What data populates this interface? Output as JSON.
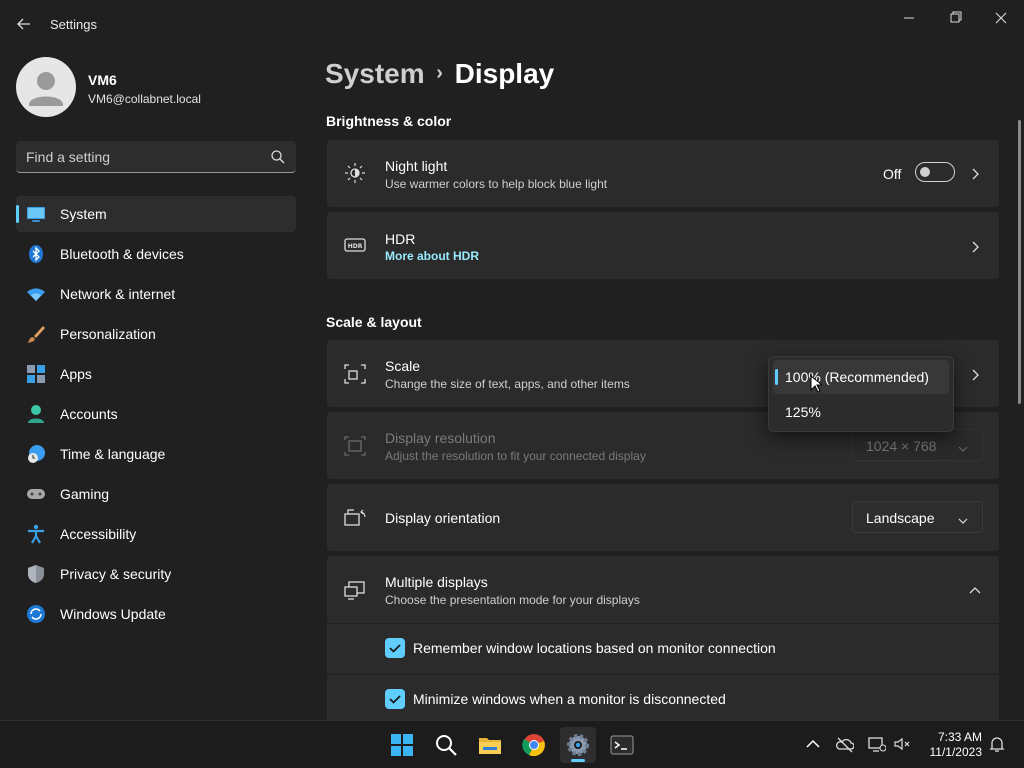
{
  "window": {
    "title": "Settings"
  },
  "user": {
    "name": "VM6",
    "email": "VM6@collabnet.local"
  },
  "search": {
    "placeholder": "Find a setting"
  },
  "nav": [
    {
      "label": "System",
      "icon": "monitor-icon",
      "active": true
    },
    {
      "label": "Bluetooth & devices",
      "icon": "bluetooth-icon"
    },
    {
      "label": "Network & internet",
      "icon": "wifi-icon"
    },
    {
      "label": "Personalization",
      "icon": "brush-icon"
    },
    {
      "label": "Apps",
      "icon": "apps-icon"
    },
    {
      "label": "Accounts",
      "icon": "person-icon"
    },
    {
      "label": "Time & language",
      "icon": "globe-clock-icon"
    },
    {
      "label": "Gaming",
      "icon": "gamepad-icon"
    },
    {
      "label": "Accessibility",
      "icon": "accessibility-icon"
    },
    {
      "label": "Privacy & security",
      "icon": "shield-icon"
    },
    {
      "label": "Windows Update",
      "icon": "update-icon"
    }
  ],
  "breadcrumb": {
    "parent": "System",
    "separator": "›",
    "current": "Display"
  },
  "sections": {
    "brightness": "Brightness & color",
    "scale_layout": "Scale & layout"
  },
  "night_light": {
    "title": "Night light",
    "subtitle": "Use warmer colors to help block blue light",
    "state": "Off"
  },
  "hdr": {
    "title": "HDR",
    "link": "More about HDR"
  },
  "scale": {
    "title": "Scale",
    "subtitle": "Change the size of text, apps, and other items",
    "options": [
      "100% (Recommended)",
      "125%"
    ],
    "selected": "100% (Recommended)"
  },
  "resolution": {
    "title": "Display resolution",
    "subtitle": "Adjust the resolution to fit your connected display",
    "value": "1024 × 768"
  },
  "orientation": {
    "title": "Display orientation",
    "value": "Landscape"
  },
  "multiple_displays": {
    "title": "Multiple displays",
    "subtitle": "Choose the presentation mode for your displays",
    "options": [
      {
        "label": "Remember window locations based on monitor connection",
        "checked": true
      },
      {
        "label": "Minimize windows when a monitor is disconnected",
        "checked": true
      }
    ]
  },
  "taskbar": {
    "apps": [
      "start-icon",
      "search-icon",
      "file-explorer-icon",
      "chrome-icon",
      "settings-icon",
      "terminal-icon"
    ],
    "active": "settings-icon"
  },
  "clock": {
    "time": "7:33 AM",
    "date": "11/1/2023"
  },
  "colors": {
    "accent": "#60cdff",
    "background": "#202020",
    "card": "#2b2b2b"
  }
}
